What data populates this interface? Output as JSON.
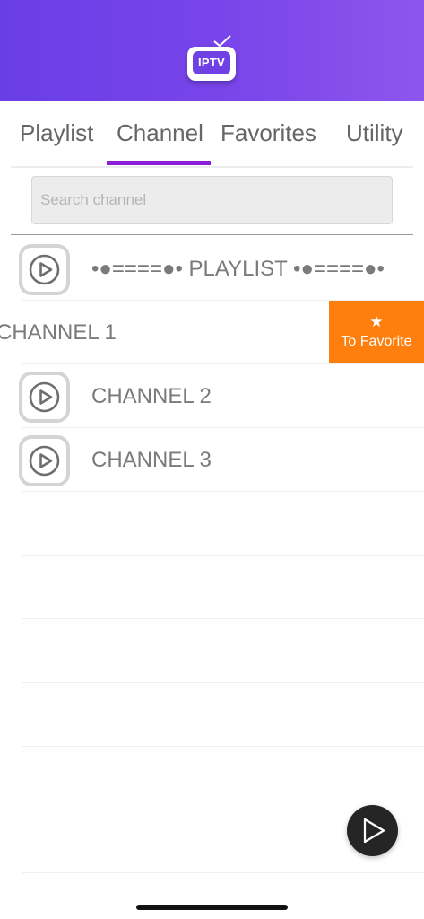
{
  "header": {
    "logo_text": "IPTV",
    "accent_color": "#7a45ea"
  },
  "tabs": [
    {
      "label": "Playlist",
      "active": false
    },
    {
      "label": "Channel",
      "active": true
    },
    {
      "label": "Favorites",
      "active": false
    },
    {
      "label": "Utility",
      "active": false
    }
  ],
  "tab_indicator_color": "#8a1fd8",
  "search": {
    "placeholder": "Search channel",
    "value": ""
  },
  "list": {
    "items": [
      {
        "label": "•●====●• PLAYLIST •●====●•",
        "icon": "play-circle-icon"
      },
      {
        "label": "CHANNEL 1",
        "icon": "play-circle-icon",
        "swiped": true
      },
      {
        "label": "CHANNEL 2",
        "icon": "play-circle-icon"
      },
      {
        "label": "CHANNEL 3",
        "icon": "play-circle-icon"
      }
    ],
    "swipe_action": {
      "label": "To Favorite",
      "icon": "star-icon",
      "color": "#ff7f0e"
    }
  },
  "fab": {
    "icon": "play-icon"
  }
}
